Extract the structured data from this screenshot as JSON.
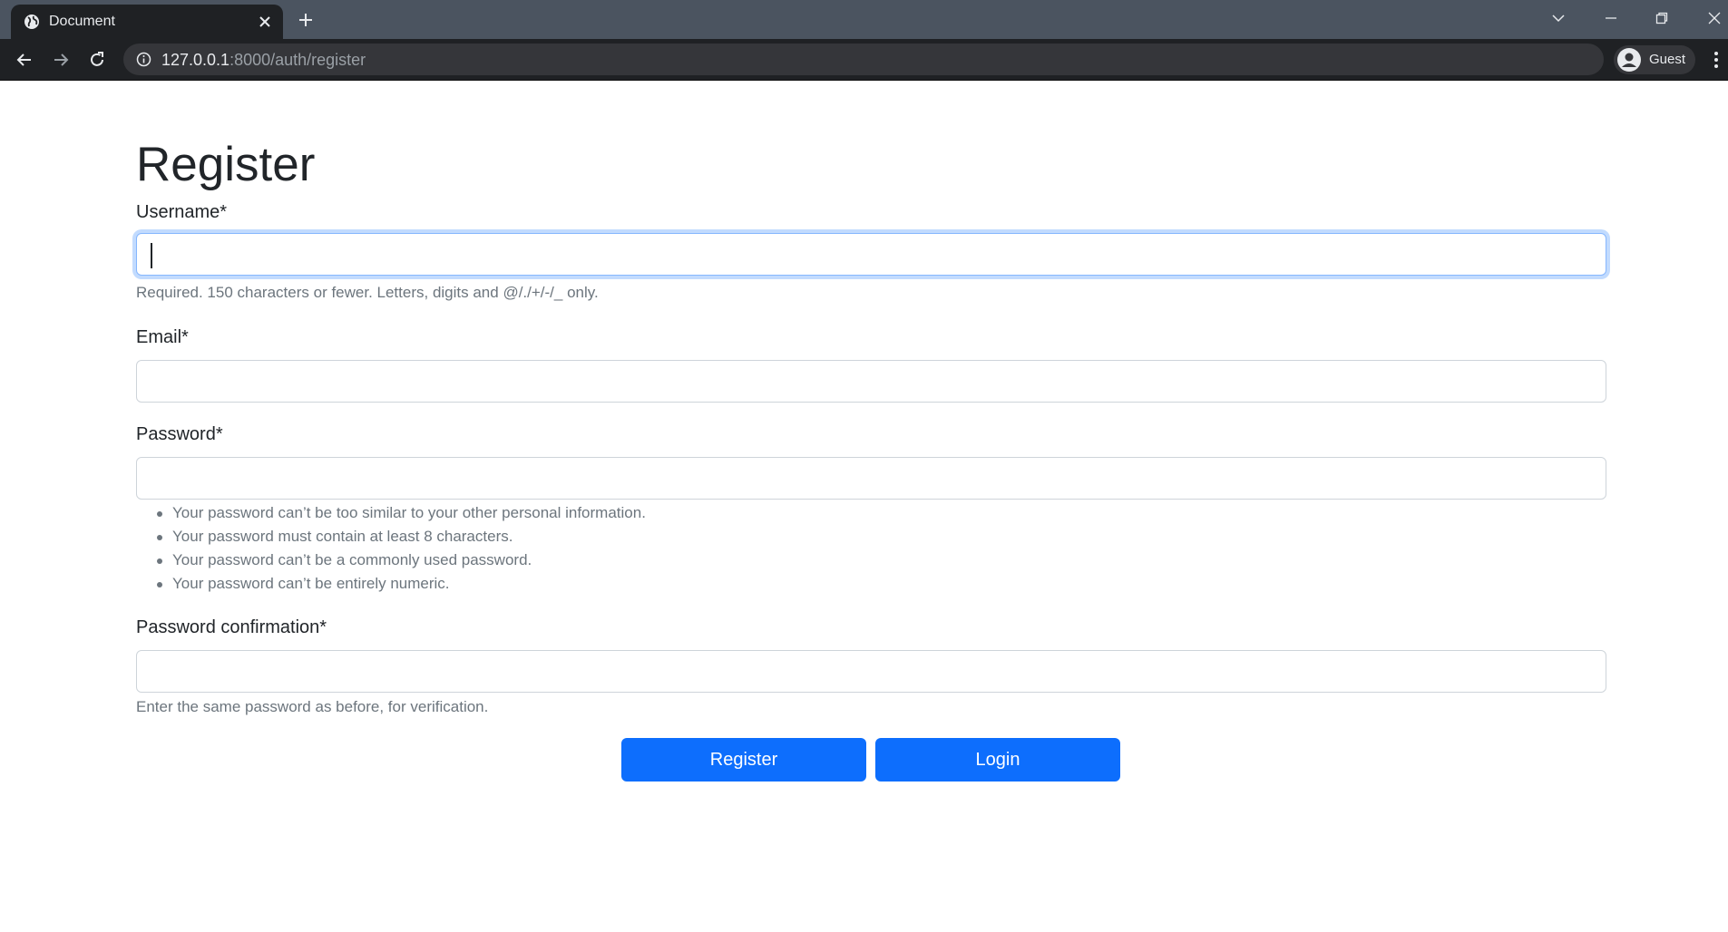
{
  "browser": {
    "tab_title": "Document",
    "url_host": "127.0.0.1",
    "url_rest": ":8000/auth/register",
    "profile_name": "Guest"
  },
  "form": {
    "title": "Register",
    "username": {
      "label": "Username*",
      "value": "",
      "help": "Required. 150 characters or fewer. Letters, digits and @/./+/-/_ only."
    },
    "email": {
      "label": "Email*",
      "value": ""
    },
    "password": {
      "label": "Password*",
      "value": "",
      "rules": [
        "Your password can’t be too similar to your other personal information.",
        "Your password must contain at least 8 characters.",
        "Your password can’t be a commonly used password.",
        "Your password can’t be entirely numeric."
      ]
    },
    "password_confirmation": {
      "label": "Password confirmation*",
      "value": "",
      "help": "Enter the same password as before, for verification."
    },
    "register_label": "Register",
    "login_label": "Login"
  },
  "colors": {
    "primary": "#0d6efd",
    "chrome_dark": "#1f2124",
    "tabstrip": "#4b5460"
  }
}
